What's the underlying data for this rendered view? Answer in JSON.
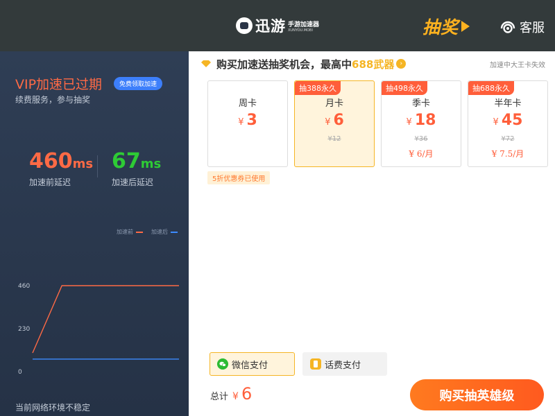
{
  "header": {
    "logo_text": "迅游",
    "logo_sub_cn": "手游加速器",
    "logo_sub_en": "XUNYOU.MOBI",
    "lottery_label": "抽奖",
    "service_label": "客服"
  },
  "left": {
    "vip_title": "VIP加速已过期",
    "vip_badge": "免费领取加速",
    "vip_sub": "续费服务，参与抽奖",
    "before_value": "460",
    "before_unit": "ms",
    "before_label": "加速前延迟",
    "after_value": "67",
    "after_unit": "ms",
    "after_label": "加速后延迟",
    "network_status": "当前网络环境不稳定"
  },
  "chart_data": {
    "type": "line",
    "series": [
      {
        "name": "加速前",
        "color": "#ff6a45",
        "values": [
          100,
          460,
          460,
          460,
          460,
          460
        ]
      },
      {
        "name": "加速后",
        "color": "#3d8bff",
        "values": [
          67,
          67,
          67,
          67,
          67,
          67
        ]
      }
    ],
    "ylim": [
      0,
      460
    ],
    "yticks": [
      "460",
      "230",
      "0"
    ],
    "legend": "top-right"
  },
  "promo": {
    "text": "购买加速送抽奖机会，最高中",
    "highlight": "688武器",
    "right_note": "加速中大王卡失效"
  },
  "plans": [
    {
      "name": "周卡",
      "currency": "¥",
      "price": "3",
      "tag": "",
      "original": "",
      "per_month": ""
    },
    {
      "name": "月卡",
      "currency": "¥",
      "price": "6",
      "tag": "抽388永久",
      "original": "¥12",
      "per_month": "",
      "selected": true
    },
    {
      "name": "季卡",
      "currency": "¥",
      "price": "18",
      "tag": "抽498永久",
      "original": "¥36",
      "per_month": "¥ 6/月"
    },
    {
      "name": "半年卡",
      "currency": "¥",
      "price": "45",
      "tag": "抽688永久",
      "original": "¥72",
      "per_month": "¥ 7.5/月"
    }
  ],
  "coupon_note": "5折优惠券已使用",
  "payment": {
    "wechat_label": "微信支付",
    "phone_label": "话费支付"
  },
  "total": {
    "label": "总计",
    "currency": "¥",
    "value": "6"
  },
  "buy_button": "购买抽英雄级",
  "colors": {
    "accent": "#ff5e3a",
    "gold": "#f5b524",
    "before_line": "#ff6a45",
    "after_line": "#3d8bff",
    "green": "#2ecb35"
  }
}
